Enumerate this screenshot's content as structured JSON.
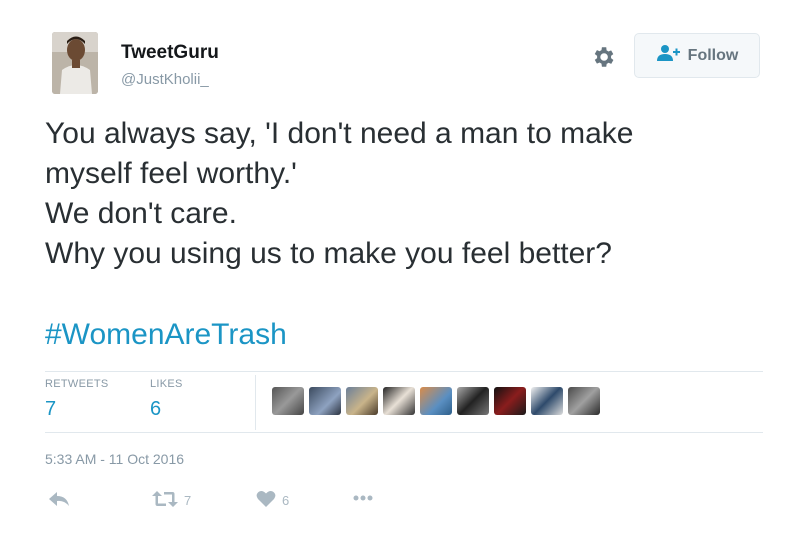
{
  "author": {
    "name": "TweetGuru",
    "handle": "@JustKholii_"
  },
  "header": {
    "follow_label": "Follow"
  },
  "tweet": {
    "lines": [
      "You always say, 'I don't need a man to make",
      "myself feel worthy.'",
      "We don't care.",
      "Why you using us to make you feel better?"
    ],
    "hashtag": "#WomenAreTrash"
  },
  "stats": {
    "retweets_label": "RETWEETS",
    "retweets_value": "7",
    "likes_label": "LIKES",
    "likes_value": "6"
  },
  "timestamp": "5:33 AM - 11 Oct 2016",
  "actions": {
    "retweet_count": "7",
    "like_count": "6"
  },
  "colors": {
    "link": "#1b95c5",
    "muted": "#8899a6",
    "icon": "#aab8c2",
    "border": "#e1e8ed"
  },
  "icons": [
    "gear-icon",
    "follow-person-icon",
    "reply-icon",
    "retweet-icon",
    "heart-icon",
    "more-icon"
  ]
}
